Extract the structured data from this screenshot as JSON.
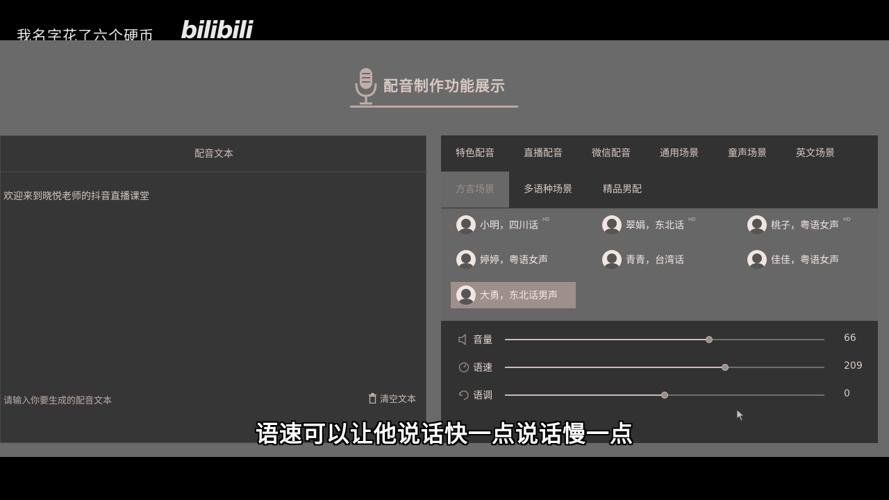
{
  "watermark": {
    "text": "我名字花了六个硬币",
    "logo": "bilibili"
  },
  "heading": {
    "title": "配音制作功能展示",
    "icon": "microphone-icon"
  },
  "left_panel": {
    "title": "配音文本",
    "content": "欢迎来到晓悦老师的抖音直播课堂",
    "hint": "请输入你要生成的配音文本",
    "clear_label": "清空文本"
  },
  "tabs": {
    "row1": [
      "特色配音",
      "直播配音",
      "微信配音",
      "通用场景",
      "童声场景",
      "英文场景"
    ],
    "row2": [
      "方言场景",
      "多语种场景",
      "精品男配"
    ],
    "active": "方言场景"
  },
  "voices": [
    {
      "name": "小明，四川话",
      "badge": "HD"
    },
    {
      "name": "翠娟，东北话",
      "badge": "HD"
    },
    {
      "name": "桃子，粤语女声",
      "badge": "HD"
    },
    {
      "name": "婷婷，粤语女声",
      "badge": ""
    },
    {
      "name": "青青，台湾话",
      "badge": ""
    },
    {
      "name": "佳佳，粤语女声",
      "badge": ""
    },
    {
      "name": "大勇，东北话男声",
      "badge": "",
      "selected": true
    }
  ],
  "sliders": [
    {
      "label": "音量",
      "value": "66",
      "fraction": 0.64,
      "icon": "volume-icon"
    },
    {
      "label": "语速",
      "value": "209",
      "fraction": 0.69,
      "icon": "speed-icon"
    },
    {
      "label": "语调",
      "value": "0",
      "fraction": 0.5,
      "icon": "pitch-icon"
    }
  ],
  "subtitle": "语速可以让他说话快一点说话慢一点",
  "colors": {
    "stage": "#6a6a6a",
    "panel": "#363636",
    "accent": "#cbbdb8"
  }
}
